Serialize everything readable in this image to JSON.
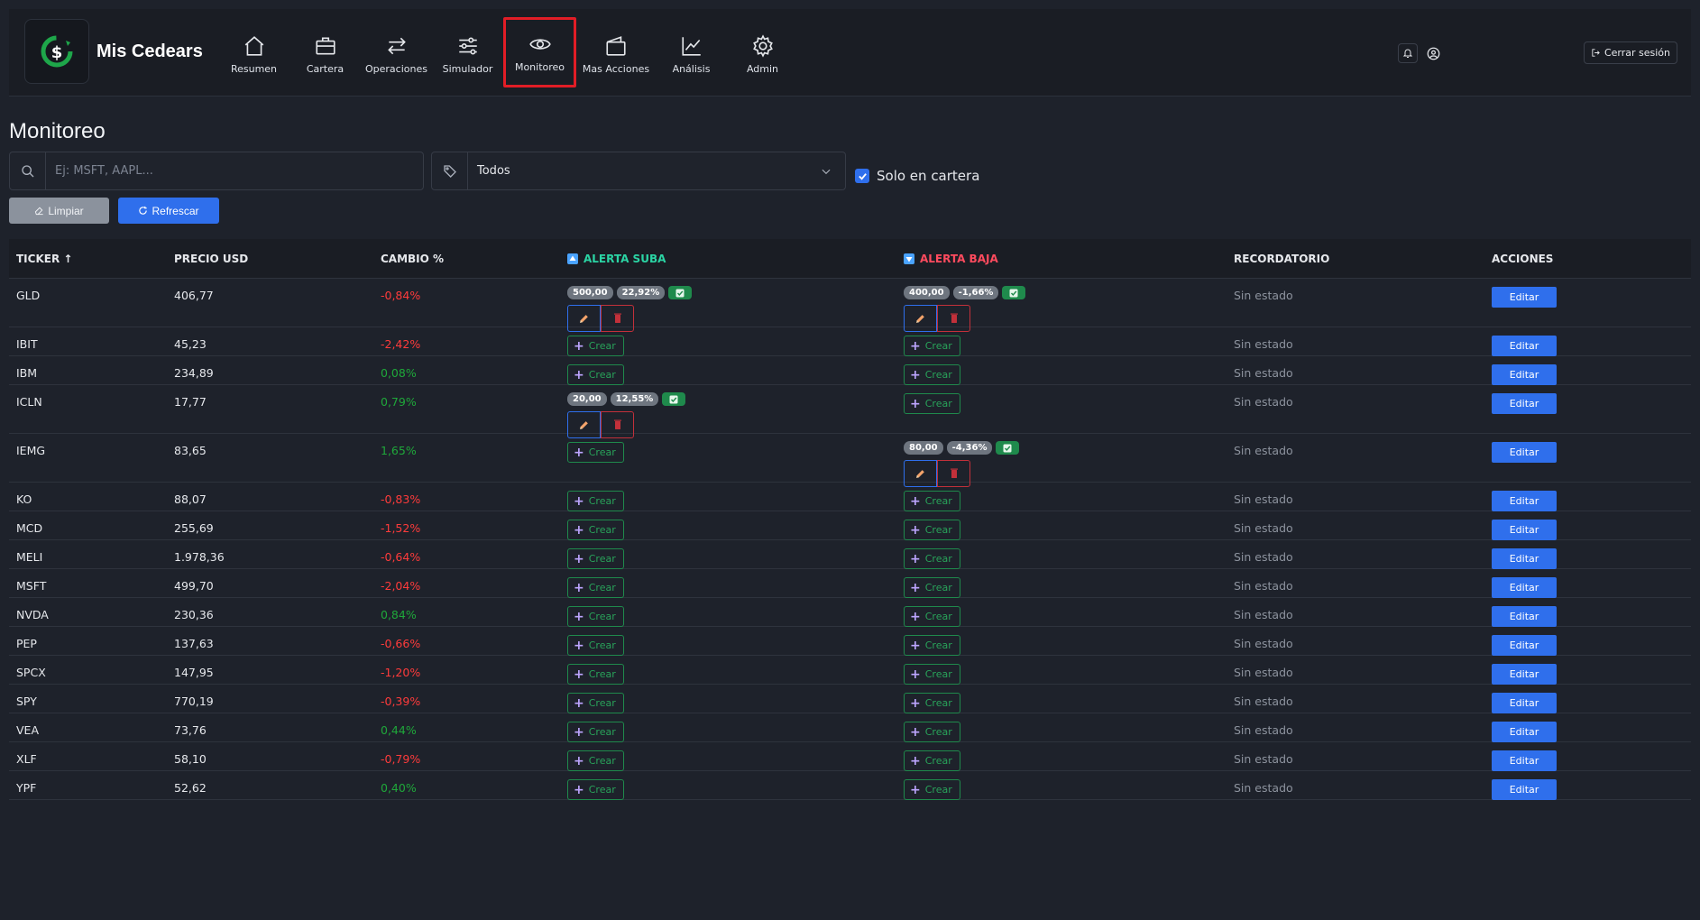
{
  "brand": {
    "name": "Mis Cedears",
    "logo_icon": "dollar-cycle-icon"
  },
  "nav": {
    "items": [
      {
        "label": "Resumen",
        "icon": "home-icon"
      },
      {
        "label": "Cartera",
        "icon": "briefcase-icon"
      },
      {
        "label": "Operaciones",
        "icon": "arrows-exchange-icon"
      },
      {
        "label": "Simulador",
        "icon": "sliders-icon"
      },
      {
        "label": "Monitoreo",
        "icon": "eye-icon",
        "active": true
      },
      {
        "label": "Mas Acciones",
        "icon": "wallet-icon"
      },
      {
        "label": "Análisis",
        "icon": "chart-line-icon"
      },
      {
        "label": "Admin",
        "icon": "gear-icon"
      }
    ],
    "logout_label": "Cerrar sesión"
  },
  "page": {
    "title": "Monitoreo",
    "search_placeholder": "Ej: MSFT, AAPL...",
    "filter_value": "Todos",
    "only_portfolio_label": "Solo en cartera",
    "only_portfolio_checked": true,
    "clear_label": "Limpiar",
    "refresh_label": "Refrescar"
  },
  "table": {
    "headers": {
      "ticker": "TICKER ↑",
      "price": "PRECIO USD",
      "change": "CAMBIO %",
      "alert_up": "ALERTA SUBA",
      "alert_down": "ALERTA BAJA",
      "reminder": "RECORDATORIO",
      "actions": "ACCIONES"
    },
    "create_label": "Crear",
    "edit_label": "Editar",
    "rows": [
      {
        "ticker": "GLD",
        "price": "406,77",
        "change": "-0,84%",
        "trend": "neg",
        "up": {
          "value": "500,00",
          "pct": "22,92%"
        },
        "down": {
          "value": "400,00",
          "pct": "-1,66%"
        },
        "reminder": "Sin estado"
      },
      {
        "ticker": "IBIT",
        "price": "45,23",
        "change": "-2,42%",
        "trend": "neg",
        "up": null,
        "down": null,
        "reminder": "Sin estado"
      },
      {
        "ticker": "IBM",
        "price": "234,89",
        "change": "0,08%",
        "trend": "pos",
        "up": null,
        "down": null,
        "reminder": "Sin estado"
      },
      {
        "ticker": "ICLN",
        "price": "17,77",
        "change": "0,79%",
        "trend": "pos",
        "up": {
          "value": "20,00",
          "pct": "12,55%"
        },
        "down": null,
        "reminder": "Sin estado"
      },
      {
        "ticker": "IEMG",
        "price": "83,65",
        "change": "1,65%",
        "trend": "pos",
        "up": null,
        "down": {
          "value": "80,00",
          "pct": "-4,36%"
        },
        "reminder": "Sin estado"
      },
      {
        "ticker": "KO",
        "price": "88,07",
        "change": "-0,83%",
        "trend": "neg",
        "up": null,
        "down": null,
        "reminder": "Sin estado"
      },
      {
        "ticker": "MCD",
        "price": "255,69",
        "change": "-1,52%",
        "trend": "neg",
        "up": null,
        "down": null,
        "reminder": "Sin estado"
      },
      {
        "ticker": "MELI",
        "price": "1.978,36",
        "change": "-0,64%",
        "trend": "neg",
        "up": null,
        "down": null,
        "reminder": "Sin estado"
      },
      {
        "ticker": "MSFT",
        "price": "499,70",
        "change": "-2,04%",
        "trend": "neg",
        "up": null,
        "down": null,
        "reminder": "Sin estado"
      },
      {
        "ticker": "NVDA",
        "price": "230,36",
        "change": "0,84%",
        "trend": "pos",
        "up": null,
        "down": null,
        "reminder": "Sin estado"
      },
      {
        "ticker": "PEP",
        "price": "137,63",
        "change": "-0,66%",
        "trend": "neg",
        "up": null,
        "down": null,
        "reminder": "Sin estado"
      },
      {
        "ticker": "SPCX",
        "price": "147,95",
        "change": "-1,20%",
        "trend": "neg",
        "up": null,
        "down": null,
        "reminder": "Sin estado"
      },
      {
        "ticker": "SPY",
        "price": "770,19",
        "change": "-0,39%",
        "trend": "neg",
        "up": null,
        "down": null,
        "reminder": "Sin estado"
      },
      {
        "ticker": "VEA",
        "price": "73,76",
        "change": "0,44%",
        "trend": "pos",
        "up": null,
        "down": null,
        "reminder": "Sin estado"
      },
      {
        "ticker": "XLF",
        "price": "58,10",
        "change": "-0,79%",
        "trend": "neg",
        "up": null,
        "down": null,
        "reminder": "Sin estado"
      },
      {
        "ticker": "YPF",
        "price": "52,62",
        "change": "0,40%",
        "trend": "pos",
        "up": null,
        "down": null,
        "reminder": "Sin estado"
      }
    ]
  },
  "colors": {
    "accent": "#2f6fec",
    "negative": "#ff3b3b",
    "positive": "#1fa83a",
    "alert_up": "#2bd4a4",
    "alert_down": "#ff4b5e",
    "highlight": "#e11d26"
  }
}
